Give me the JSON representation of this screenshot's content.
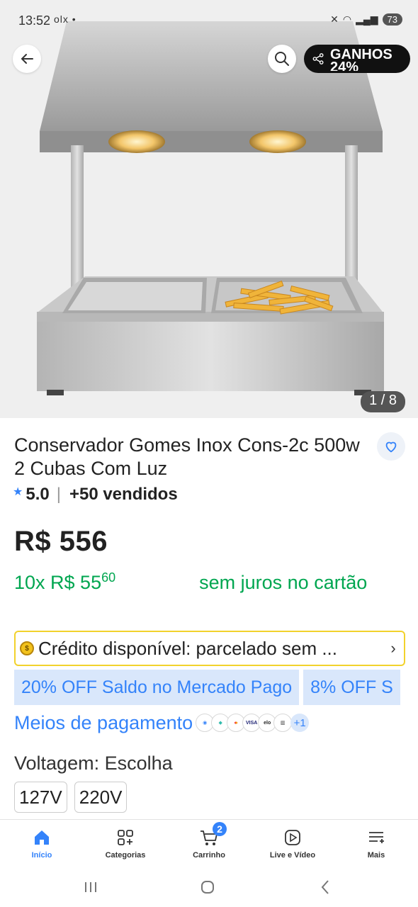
{
  "status_bar": {
    "time": "13:52",
    "apps": "olx •",
    "battery": "73"
  },
  "hero": {
    "share_label": "GANHOS 24%",
    "image_counter": "1 / 8",
    "image_subject": "stainless steel food warmer with two heat lamps, two trays, one holding french fries"
  },
  "product": {
    "title": "Conservador Gomes Inox Cons-2c 500w 2 Cubas Com Luz",
    "rating": "5.0",
    "separator": "|",
    "sold": "+50 vendidos",
    "price": "R$ 556",
    "installment_prefix": "10x R$ 55",
    "installment_cents": "60",
    "installment_suffix": "sem juros no cartão",
    "credit_text": "Crédito disponível: parcelado sem ...",
    "promos": [
      "20% OFF Saldo no Mercado Pago",
      "8% OFF S"
    ],
    "payment_methods_label": "Meios de pagamento",
    "payment_more": "+1",
    "voltage_label": "Voltagem: Escolha",
    "voltage_options": [
      "127V",
      "220V"
    ]
  },
  "bottom_nav": {
    "items": [
      {
        "label": "Início",
        "icon": "home-icon"
      },
      {
        "label": "Categorias",
        "icon": "categories-icon"
      },
      {
        "label": "Carrinho",
        "icon": "cart-icon",
        "badge": "2"
      },
      {
        "label": "Live e Vídeo",
        "icon": "video-icon"
      },
      {
        "label": "Mais",
        "icon": "menu-icon"
      }
    ]
  },
  "colors": {
    "accent_blue": "#3483fa",
    "green": "#00a650",
    "credit_border": "#f2d22c",
    "promo_bg": "#d9e7fb"
  }
}
